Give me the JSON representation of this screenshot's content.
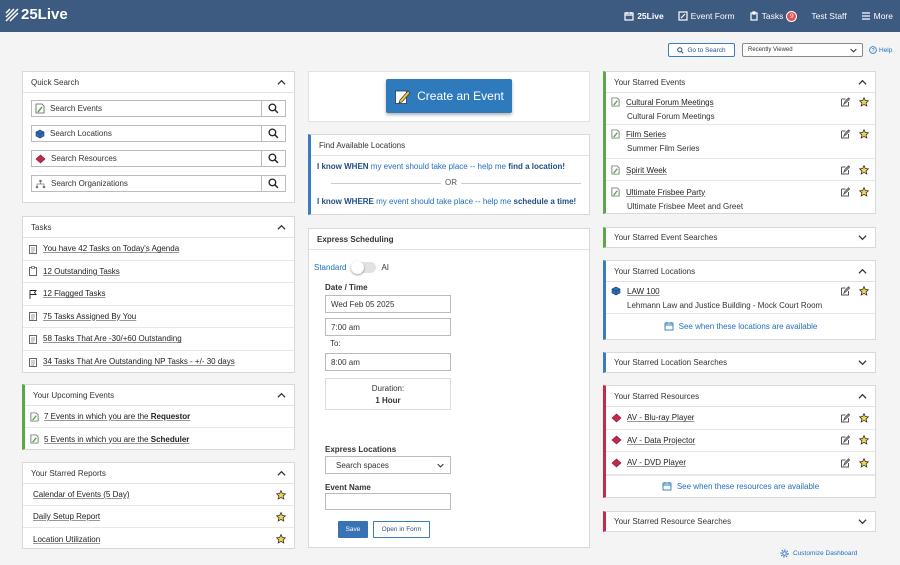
{
  "app": {
    "logo": "25Live"
  },
  "nav": {
    "home_label": "25Live",
    "event_form_label": "Event Form",
    "tasks_label": "Tasks",
    "tasks_count": "9",
    "user_label": "Test Staff",
    "more_label": "More"
  },
  "utility": {
    "go_to_search": "Go to Search",
    "recently_viewed": "Recently Viewed",
    "help": "Help"
  },
  "quick_search": {
    "title": "Quick Search",
    "items": [
      "Search Events",
      "Search Locations",
      "Search Resources",
      "Search Organizations"
    ]
  },
  "tasks": {
    "title": "Tasks",
    "items": [
      "You have 42 Tasks on Today's Agenda",
      "12 Outstanding Tasks",
      "12 Flagged Tasks",
      "75 Tasks Assigned By You",
      "58 Tasks That Are -30/+60 Outstanding",
      "34 Tasks That Are Outstanding NP Tasks - +/- 30 days"
    ]
  },
  "upcoming": {
    "title": "Your Upcoming Events",
    "items": [
      {
        "text": "7 Events in which you are the ",
        "role": "Requestor"
      },
      {
        "text": "5 Events in which you are the ",
        "role": "Scheduler"
      }
    ]
  },
  "reports": {
    "title": "Your Starred Reports",
    "items": [
      "Calendar of Events (5 Day)",
      "Daily Setup Report",
      "Location Utilization"
    ]
  },
  "create_event": {
    "label": "Create an Event"
  },
  "find_locations": {
    "title": "Find Available Locations",
    "when_bold": "I know WHEN",
    "when_mid": " my event should take place -- help me ",
    "when_link": "find a location!",
    "or": "OR",
    "where_bold": "I know WHERE",
    "where_mid": " my event should take place -- help me ",
    "where_link": "schedule a time!"
  },
  "express": {
    "title": "Express Scheduling",
    "mode_standard": "Standard",
    "mode_ai": "AI",
    "date_time_label": "Date / Time",
    "date": "Wed Feb 05 2025",
    "start_time": "7:00 am",
    "to_label": "To:",
    "end_time": "8:00 am",
    "duration_label": "Duration:",
    "duration_value": "1 Hour",
    "locations_label": "Express Locations",
    "locations_placeholder": "Search spaces",
    "event_name_label": "Event Name",
    "event_name_value": "",
    "save_label": "Save",
    "open_form_label": "Open in Form"
  },
  "starred_events": {
    "title": "Your Starred Events",
    "items": [
      {
        "name": "Cultural Forum Meetings",
        "sub": "Cultural Forum Meetings"
      },
      {
        "name": "Film Series",
        "sub": "Summer Film Series"
      },
      {
        "name": "Spirit Week",
        "sub": ""
      },
      {
        "name": "Ultimate Frisbee Party",
        "sub": "Ultimate Frisbee Meet and Greet"
      }
    ]
  },
  "event_searches": {
    "title": "Your Starred Event Searches"
  },
  "starred_locations": {
    "title": "Your Starred Locations",
    "items": [
      {
        "name": "LAW 100",
        "sub": "Lehmann Law and Justice Building - Mock Court Room"
      }
    ],
    "availability_link": "See when these locations are available"
  },
  "location_searches": {
    "title": "Your Starred Location Searches"
  },
  "starred_resources": {
    "title": "Your Starred Resources",
    "items": [
      "AV - Blu-ray Player",
      "AV - Data Projector",
      "AV - DVD Player"
    ],
    "availability_link": "See when these resources are available"
  },
  "resource_searches": {
    "title": "Your Starred Resource Searches"
  },
  "footer": {
    "customize": "Customize Dashboard"
  },
  "colors": {
    "topbar": "#3d5a80",
    "accent_blue": "#2e7abd",
    "events_green": "#5aa84a",
    "resources_red": "#c8284a",
    "star_yellow": "#f5d44a"
  }
}
